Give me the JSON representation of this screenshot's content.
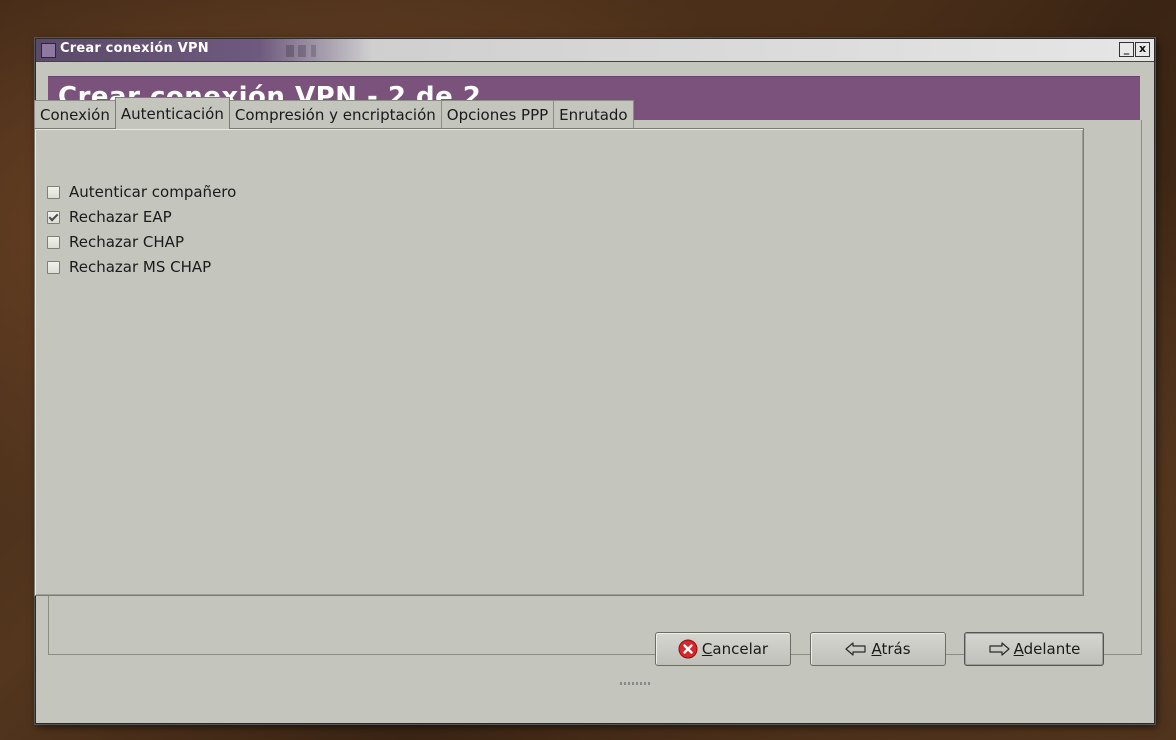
{
  "window": {
    "title": "Crear conexión VPN",
    "minimize_symbol": "_",
    "close_symbol": "x"
  },
  "header": {
    "title": "Crear conexión VPN - 2 de 2"
  },
  "tabs": [
    {
      "label": "Conexión",
      "active": false
    },
    {
      "label": "Autenticación",
      "active": true
    },
    {
      "label": "Compresión y encriptación",
      "active": false
    },
    {
      "label": "Opciones PPP",
      "active": false
    },
    {
      "label": "Enrutado",
      "active": false
    }
  ],
  "options": [
    {
      "label": "Autenticar compañero",
      "checked": false
    },
    {
      "label": "Rechazar EAP",
      "checked": true
    },
    {
      "label": "Rechazar CHAP",
      "checked": false
    },
    {
      "label": "Rechazar MS CHAP",
      "checked": false
    }
  ],
  "buttons": {
    "cancel": {
      "mnemonic": "C",
      "rest": "ancelar",
      "icon": "cancel-x-icon"
    },
    "back": {
      "mnemonic": "A",
      "rest": "trás",
      "icon": "arrow-left-icon"
    },
    "next": {
      "mnemonic": "A",
      "rest": "delante",
      "icon": "arrow-right-icon"
    }
  },
  "colors": {
    "header_band": "#7a527c",
    "window_bg": "#c4c6be",
    "cancel_icon": "#d8262b"
  }
}
